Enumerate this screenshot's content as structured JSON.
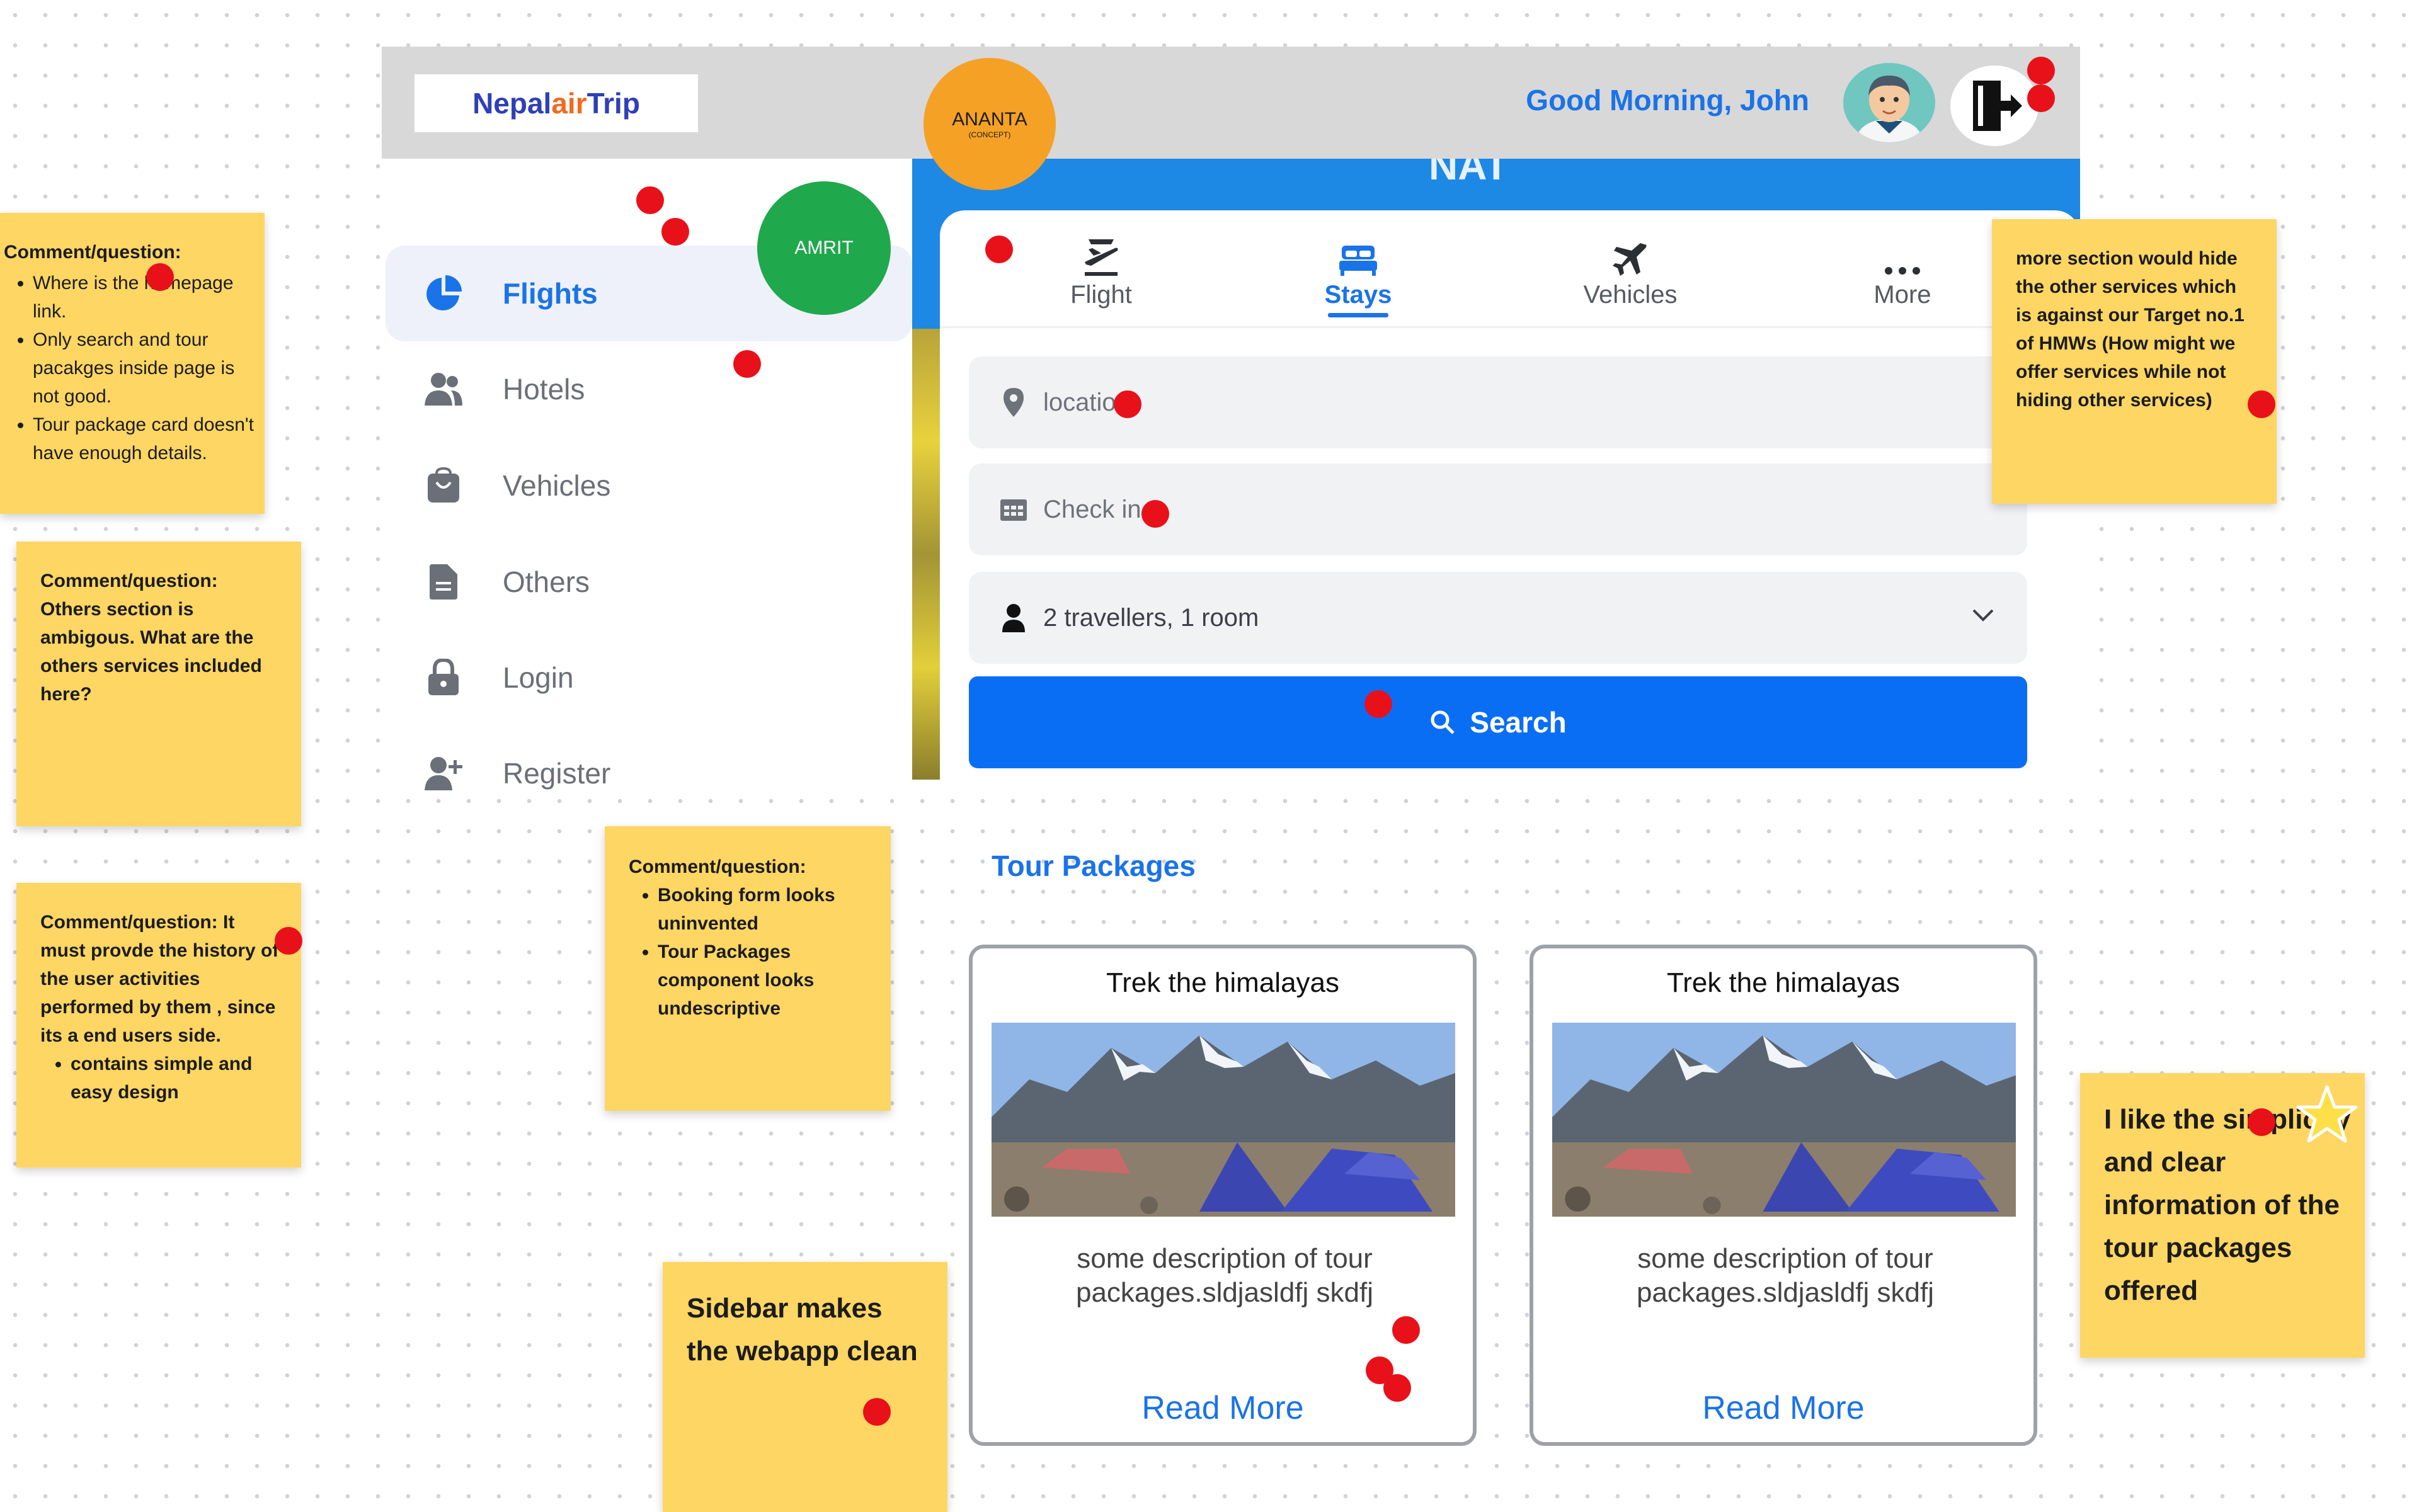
{
  "brand": {
    "part1": "Nepal",
    "part2": "air",
    "part3": "Trip",
    "color1": "#2f3fb7",
    "color2": "#f06a1f",
    "color3": "#2f3fb7"
  },
  "header": {
    "greeting": "Good Morning, John"
  },
  "sidebar": {
    "items": [
      {
        "label": "Flights",
        "icon": "pie-chart-icon",
        "active": true
      },
      {
        "label": "Hotels",
        "icon": "users-icon"
      },
      {
        "label": "Vehicles",
        "icon": "bag-icon"
      },
      {
        "label": "Others",
        "icon": "document-icon"
      },
      {
        "label": "Login",
        "icon": "lock-icon"
      },
      {
        "label": "Register",
        "icon": "user-plus-icon"
      }
    ]
  },
  "hero": {
    "title_fragment": "NAT"
  },
  "booking": {
    "tabs": [
      {
        "label": "Flight",
        "icon": "flight-takeoff-icon"
      },
      {
        "label": "Stays",
        "icon": "bed-icon",
        "active": true
      },
      {
        "label": "Vehicles",
        "icon": "plane-icon"
      },
      {
        "label": "More",
        "icon": "more-dots-icon"
      }
    ],
    "location_text": "locatio",
    "checkin_text": "Check in",
    "travellers_text": "2 travellers, 1 room",
    "search_label": "Search"
  },
  "tours": {
    "title": "Tour Packages",
    "packages": [
      {
        "title": "Trek the himalayas",
        "description": "some description of tour packages.sldjasldfj skdfj",
        "cta": "Read More"
      },
      {
        "title": "Trek the himalayas",
        "description": "some description of tour packages.sldjasldfj skdfj",
        "cta": "Read More"
      }
    ]
  },
  "avatars": {
    "ananta": {
      "name": "ANANTA",
      "tag": "(CONCEPT)",
      "color": "#f5a125"
    },
    "amrit": {
      "name": "AMRIT",
      "color": "#1fa94c"
    }
  },
  "notes": {
    "n1": {
      "title": "Comment/question:",
      "items": [
        "Where is the homepage link.",
        "Only search and tour pacakges inside page is not good.",
        "Tour package card doesn't have enough details."
      ]
    },
    "n2": {
      "text": "Comment/question: Others section is ambigous. What are the others services included here?"
    },
    "n3": {
      "text": "Comment/question: It must provde the history of the user activities performed by them , since its a end users side.",
      "items": [
        "contains simple and easy design"
      ]
    },
    "n4": {
      "title": "Comment/question:",
      "items": [
        "Booking form looks uninvented",
        "Tour Packages component looks undescriptive"
      ]
    },
    "n5": {
      "text": "Sidebar makes the webapp clean"
    },
    "n6": {
      "text": "more section would hide the other services which is against our Target no.1 of HMWs (How might we offer services while not hiding other services)"
    },
    "n7": {
      "text": "I like the simplicity and clear information of the tour packages offered"
    }
  },
  "colors": {
    "accent": "#1a73e8",
    "note": "#fdd663",
    "vote_dot": "#e8111a",
    "search": "#0a6ef5"
  }
}
